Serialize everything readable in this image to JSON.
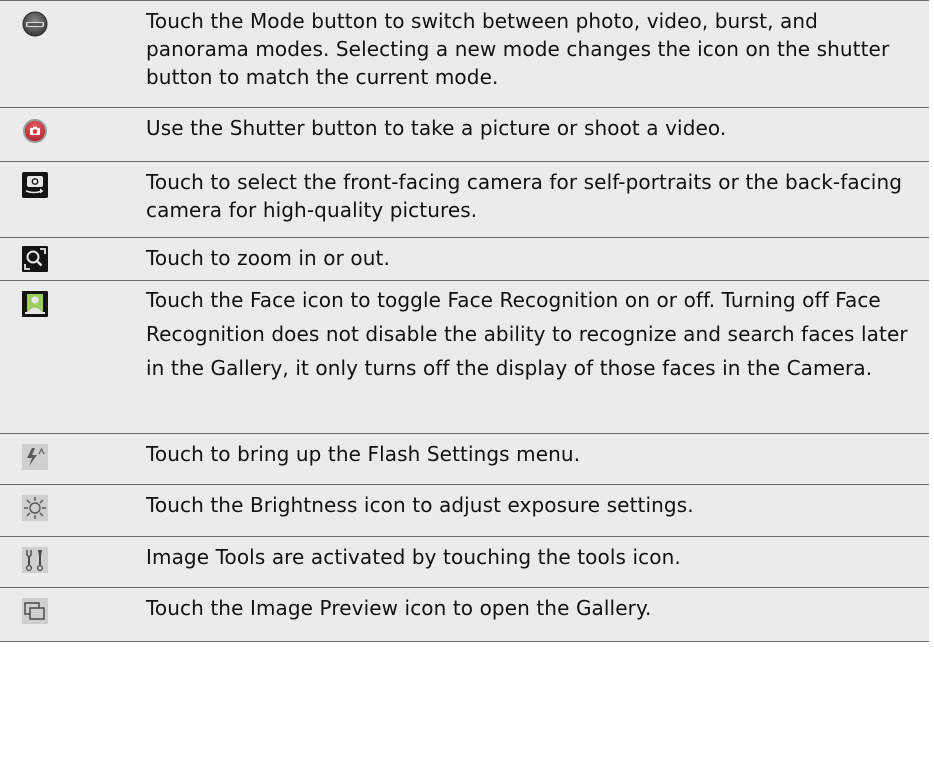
{
  "rows": [
    {
      "icon": "mode-icon",
      "text": "Touch the Mode button to switch between photo, video, burst, and panorama modes. Selecting a new mode changes the icon on the shutter button to match the current mode."
    },
    {
      "icon": "shutter-icon",
      "text": "Use the Shutter button to take a picture or shoot a video."
    },
    {
      "icon": "switch-camera-icon",
      "text": "Touch to select the front-facing camera for self-portraits or the back-facing camera for high-quality pictures."
    },
    {
      "icon": "zoom-icon",
      "text": "Touch to zoom in or out."
    },
    {
      "icon": "face-recognition-icon",
      "text": "Touch the Face icon to toggle Face Recognition on or off. Turning off Face Recognition does not disable the ability to recognize and search faces later in the Gallery, it only turns off the display of those faces in the Camera."
    },
    {
      "icon": "flash-icon",
      "text": "Touch to bring up the Flash Settings menu."
    },
    {
      "icon": "brightness-icon",
      "text": "Touch the Brightness icon to adjust exposure settings."
    },
    {
      "icon": "tools-icon",
      "text": "Image Tools are activated by touching the tools icon."
    },
    {
      "icon": "image-preview-icon",
      "text": "Touch the Image Preview icon to open the Gallery."
    }
  ],
  "colors": {
    "row_background": "#ebebeb",
    "divider": "#6a6a6a",
    "text": "#111111",
    "shutter_red": "#d9353b"
  }
}
